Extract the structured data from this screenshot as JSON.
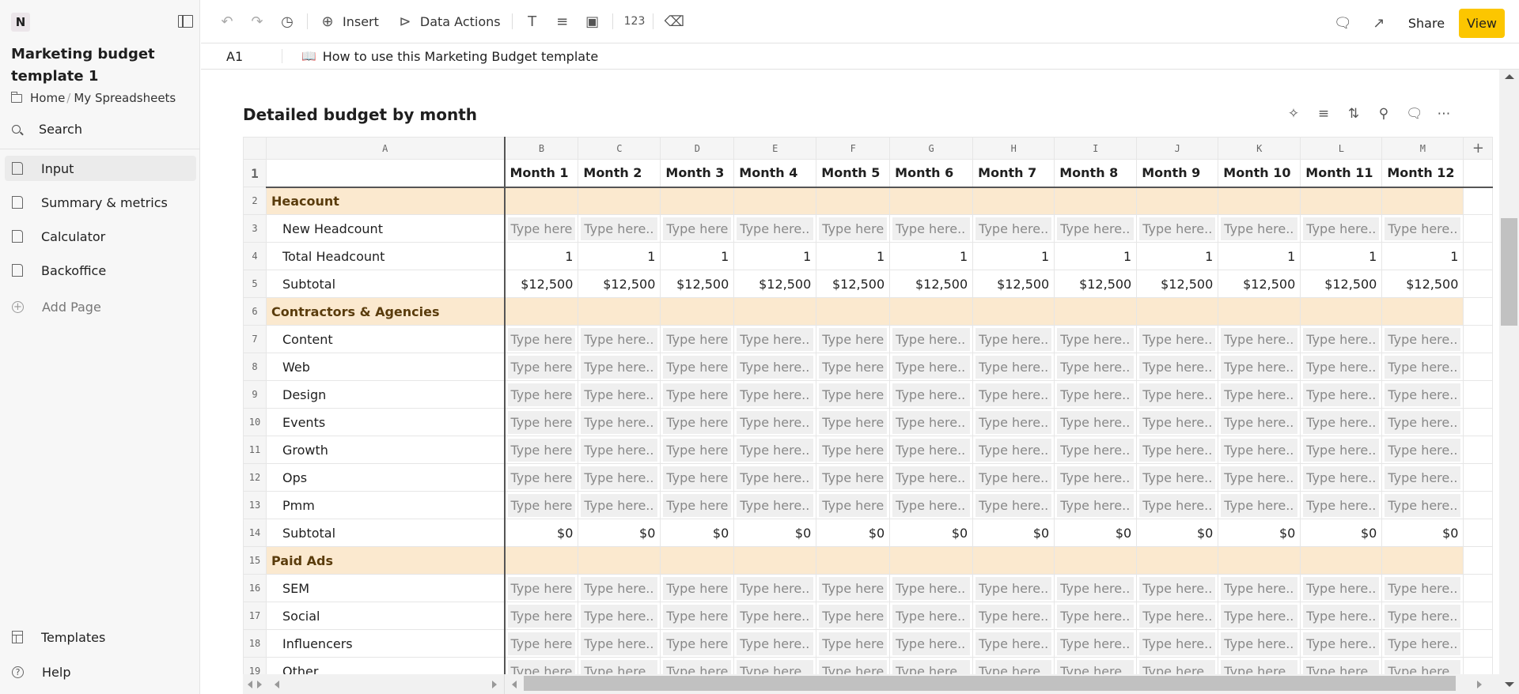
{
  "app": {
    "logo": "N"
  },
  "sidebar": {
    "doc_title": "Marketing budget template 1",
    "breadcrumb": [
      "Home",
      "My Spreadsheets"
    ],
    "search_label": "Search",
    "pages": [
      {
        "label": "Input",
        "active": true
      },
      {
        "label": "Summary & metrics",
        "active": false
      },
      {
        "label": "Calculator",
        "active": false
      },
      {
        "label": "Backoffice",
        "active": false
      }
    ],
    "add_page_label": "Add Page",
    "templates_label": "Templates",
    "help_label": "Help"
  },
  "toolbar": {
    "insert_label": "Insert",
    "data_actions_label": "Data Actions",
    "share_label": "Share",
    "view_label": "View",
    "view_color": "#fcc600"
  },
  "formula_bar": {
    "cell_ref": "A1",
    "icon": "📖",
    "text": "How to use this Marketing Budget template"
  },
  "sheet": {
    "title": "Detailed budget by month",
    "column_letters": [
      "A",
      "B",
      "C",
      "D",
      "E",
      "F",
      "G",
      "H",
      "I",
      "J",
      "K",
      "L",
      "M"
    ],
    "add_column_label": "+",
    "months": [
      "Month 1",
      "Month 2",
      "Month 3",
      "Month 4",
      "Month 5",
      "Month 6",
      "Month 7",
      "Month 8",
      "Month 9",
      "Month 10",
      "Month 11",
      "Month 12"
    ],
    "placeholder_short": "Type here",
    "placeholder_long": "Type here..",
    "rows": [
      {
        "n": "2",
        "type": "section",
        "label": "Heacount"
      },
      {
        "n": "3",
        "type": "input",
        "label": "New Headcount"
      },
      {
        "n": "4",
        "type": "value",
        "label": "Total Headcount",
        "values": [
          "1",
          "1",
          "1",
          "1",
          "1",
          "1",
          "1",
          "1",
          "1",
          "1",
          "1",
          "1"
        ]
      },
      {
        "n": "5",
        "type": "value",
        "label": "Subtotal",
        "values": [
          "$12,500",
          "$12,500",
          "$12,500",
          "$12,500",
          "$12,500",
          "$12,500",
          "$12,500",
          "$12,500",
          "$12,500",
          "$12,500",
          "$12,500",
          "$12,500"
        ]
      },
      {
        "n": "6",
        "type": "section",
        "label": "Contractors & Agencies"
      },
      {
        "n": "7",
        "type": "input",
        "label": "Content"
      },
      {
        "n": "8",
        "type": "input",
        "label": "Web"
      },
      {
        "n": "9",
        "type": "input",
        "label": "Design"
      },
      {
        "n": "10",
        "type": "input",
        "label": "Events"
      },
      {
        "n": "11",
        "type": "input",
        "label": "Growth"
      },
      {
        "n": "12",
        "type": "input",
        "label": "Ops"
      },
      {
        "n": "13",
        "type": "input",
        "label": "Pmm"
      },
      {
        "n": "14",
        "type": "value",
        "label": "Subtotal",
        "values": [
          "$0",
          "$0",
          "$0",
          "$0",
          "$0",
          "$0",
          "$0",
          "$0",
          "$0",
          "$0",
          "$0",
          "$0"
        ]
      },
      {
        "n": "15",
        "type": "section",
        "label": "Paid Ads"
      },
      {
        "n": "16",
        "type": "input",
        "label": "SEM"
      },
      {
        "n": "17",
        "type": "input",
        "label": "Social"
      },
      {
        "n": "18",
        "type": "input",
        "label": "Influencers"
      },
      {
        "n": "19",
        "type": "input",
        "label": "Other"
      }
    ]
  }
}
